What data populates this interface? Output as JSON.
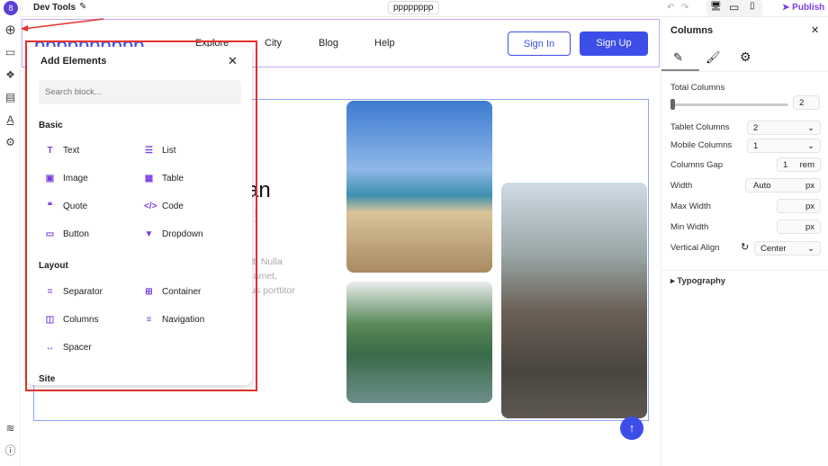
{
  "topbar": {
    "title": "Dev Tools",
    "page_name": "pppppppp",
    "publish": "Publish"
  },
  "site": {
    "logo": "pppppppppp",
    "nav": [
      "Explore",
      "City",
      "Blog",
      "Help"
    ],
    "sign_in": "Sign In",
    "sign_up": "Sign Up",
    "heading": "can",
    "heading2": "!",
    "paragraph": [
      "ng elit. Nulla",
      "or sit amet,",
      "aximus porttitor"
    ]
  },
  "add_elements": {
    "title": "Add Elements",
    "search_placeholder": "Search block...",
    "groups": [
      {
        "name": "Basic",
        "items": [
          {
            "label": "Text",
            "icon": "T"
          },
          {
            "label": "List",
            "icon": "☰"
          },
          {
            "label": "Image",
            "icon": "▣"
          },
          {
            "label": "Table",
            "icon": "▦"
          },
          {
            "label": "Quote",
            "icon": "❝"
          },
          {
            "label": "Code",
            "icon": "</>"
          },
          {
            "label": "Button",
            "icon": "▭"
          },
          {
            "label": "Dropdown",
            "icon": "▼"
          }
        ]
      },
      {
        "name": "Layout",
        "items": [
          {
            "label": "Separator",
            "icon": "="
          },
          {
            "label": "Container",
            "icon": "⊞"
          },
          {
            "label": "Columns",
            "icon": "◫"
          },
          {
            "label": "Navigation",
            "icon": "≡"
          },
          {
            "label": "Spacer",
            "icon": "↔"
          }
        ]
      },
      {
        "name": "Site",
        "items": []
      }
    ]
  },
  "panel": {
    "title": "Columns",
    "total_columns_label": "Total Columns",
    "total_columns": "2",
    "tablet_label": "Tablet Columns",
    "tablet": "2",
    "mobile_label": "Mobile Columns",
    "mobile": "1",
    "gap_label": "Columns Gap",
    "gap": "1",
    "gap_unit": "rem",
    "width_label": "Width",
    "width": "Auto",
    "px": "px",
    "max_width_label": "Max Width",
    "min_width_label": "Min Width",
    "valign_label": "Vertical Align",
    "valign": "Center",
    "typography": "Typography"
  },
  "colors": {
    "accent": "#3d4ee8",
    "purple": "#7b3fe4",
    "highlight": "#e5322d"
  }
}
